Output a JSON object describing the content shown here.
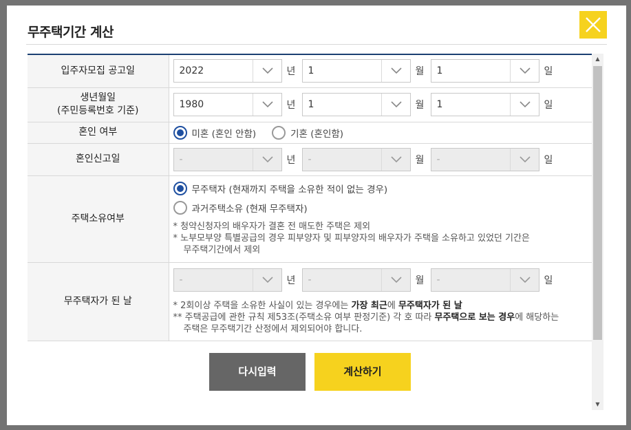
{
  "modal": {
    "title": "무주택기간 계산",
    "close_icon": "close-x-icon"
  },
  "rows": {
    "announce": {
      "label": "입주자모집 공고일",
      "year": "2022",
      "year_unit": "년",
      "month": "1",
      "month_unit": "월",
      "day": "1",
      "day_unit": "일"
    },
    "birth": {
      "label_line1": "생년월일",
      "label_line2": "(주민등록번호 기준)",
      "year": "1980",
      "year_unit": "년",
      "month": "1",
      "month_unit": "월",
      "day": "1",
      "day_unit": "일"
    },
    "marital": {
      "label": "혼인 여부",
      "option_single": "미혼 (혼인 안함)",
      "option_married": "기혼 (혼인함)",
      "selected": "미혼 (혼인 안함)"
    },
    "marriage_report": {
      "label": "혼인신고일",
      "year": "-",
      "year_unit": "년",
      "month": "-",
      "month_unit": "월",
      "day": "-",
      "day_unit": "일"
    },
    "ownership": {
      "label": "주택소유여부",
      "option_never": "무주택자 (현재까지 주택을 소유한 적이 없는 경우)",
      "option_past": "과거주택소유 (현재 무주택자)",
      "selected": "무주택자 (현재까지 주택을 소유한 적이 없는 경우)",
      "note1": "* 청약신청자의 배우자가 결혼 전 매도한 주택은 제외",
      "note2_line1": "* 노부모부양 특별공급의 경우 피부양자 및 피부양자의 배우자가 주택을 소유하고 있었던 기간은",
      "note2_line2": "무주택기간에서 제외"
    },
    "homeless_date": {
      "label": "무주택자가 된 날",
      "year": "-",
      "year_unit": "년",
      "month": "-",
      "month_unit": "월",
      "day": "-",
      "day_unit": "일",
      "note1_pre": "* 2회이상 주택을 소유한 사실이 있는 경우에는 ",
      "note1_bold1": "가장 최근",
      "note1_mid": "에 ",
      "note1_bold2": "무주택자가 된 날",
      "note2_pre": "** 주택공급에 관한 규칙 제53조(주택소유 여부 판정기준) 각 호 따라 ",
      "note2_bold": "무주택으로 보는 경우",
      "note2_post": "에 해당하는",
      "note3": "주택은 무주택기간 산정에서 제외되어야 합니다."
    }
  },
  "buttons": {
    "reset": "다시입력",
    "calculate": "계산하기"
  },
  "colors": {
    "accent_yellow": "#f6d21e",
    "reset_gray": "#666666",
    "radio_blue": "#1e4fa0",
    "header_rule_navy": "#1b3f72"
  }
}
